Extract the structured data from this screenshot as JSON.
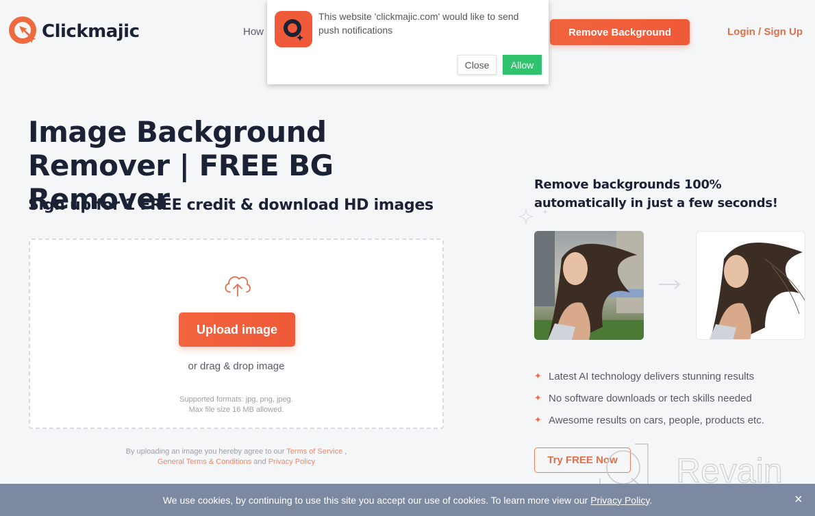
{
  "brand": {
    "name": "Clickmajic",
    "accent": "#ef5a38",
    "dark": "#1b2235"
  },
  "nav": {
    "how_label": "How",
    "remove_bg_label": "Remove Background",
    "login_label": "Login / Sign Up"
  },
  "push_popup": {
    "message": "This website 'clickmajic.com' would like to send push notifications",
    "close_label": "Close",
    "allow_label": "Allow",
    "allow_color": "#31c26d"
  },
  "hero": {
    "title": "Image Background Remover | FREE BG Remover",
    "subtitle": "Sign up for 1 FREE credit & download HD images"
  },
  "upload": {
    "icon": "cloud-upload-icon",
    "button_label": "Upload image",
    "drag_text": "or drag & drop image",
    "formats_line1": "Supported formats: jpg, png, jpeg.",
    "formats_line2": "Max file size 16 MB allowed."
  },
  "agreement": {
    "prefix": "By uploading an image you hereby agree to our ",
    "terms_link": "Terms of Service",
    "sep": " ,",
    "general_link": "General Terms & Conditions",
    "and": " and ",
    "privacy_link": "Privacy Policy"
  },
  "right_panel": {
    "title": "Remove backgrounds 100% automatically in just a few seconds!",
    "before_image_alt": "woman with city background",
    "after_image_alt": "woman with background removed",
    "bullets": [
      "Latest AI technology delivers stunning results",
      "No software downloads or tech skills needed",
      "Awesome results on cars, people, products etc."
    ],
    "try_label": "Try FREE Now"
  },
  "watermark": {
    "text": "Revain"
  },
  "cookie": {
    "text": "We use cookies, by continuing to use this site you accept our use of cookies. To learn more view our ",
    "link": "Privacy Policy",
    "suffix": ".",
    "close_icon": "×"
  }
}
